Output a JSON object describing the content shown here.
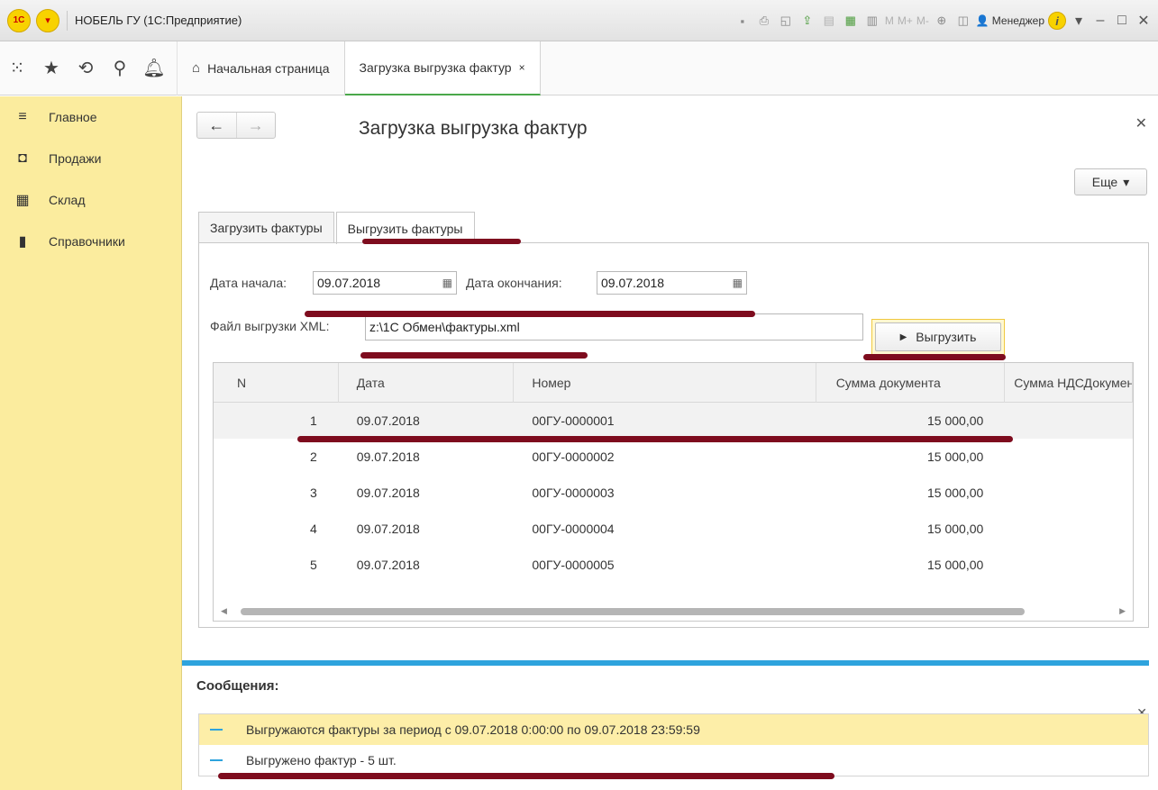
{
  "window": {
    "logo_text": "1С",
    "title": "НОБЕЛЬ ГУ  (1С:Предприятие)",
    "memory_buttons": [
      "M",
      "M+",
      "M-"
    ],
    "user": "Менеджер"
  },
  "toolbar": {
    "tabs": [
      {
        "label": "Начальная страница"
      },
      {
        "label": "Загрузка выгрузка фактур",
        "close": "×"
      }
    ]
  },
  "sidebar": {
    "items": [
      {
        "label": "Главное",
        "icon": "menu-icon"
      },
      {
        "label": "Продажи",
        "icon": "bag-icon"
      },
      {
        "label": "Склад",
        "icon": "warehouse-icon"
      },
      {
        "label": "Справочники",
        "icon": "books-icon"
      }
    ]
  },
  "page": {
    "title": "Загрузка выгрузка фактур",
    "more_label": "Еще"
  },
  "form_tabs": [
    {
      "label": "Загрузить фактуры"
    },
    {
      "label": "Выгрузить фактуры"
    }
  ],
  "form": {
    "start_label": "Дата начала:",
    "start_value": "09.07.2018",
    "end_label": "Дата окончания:",
    "end_value": "09.07.2018",
    "file_label": "Файл выгрузки XML:",
    "file_value": "z:\\1С Обмен\\фактуры.xml",
    "export_label": "Выгрузить"
  },
  "table": {
    "headers": [
      "N",
      "Дата",
      "Номер",
      "Сумма документа",
      "Сумма НДСДокумента"
    ],
    "rows": [
      [
        "1",
        "09.07.2018",
        "00ГУ-0000001",
        "15 000,00",
        ""
      ],
      [
        "2",
        "09.07.2018",
        "00ГУ-0000002",
        "15 000,00",
        ""
      ],
      [
        "3",
        "09.07.2018",
        "00ГУ-0000003",
        "15 000,00",
        ""
      ],
      [
        "4",
        "09.07.2018",
        "00ГУ-0000004",
        "15 000,00",
        ""
      ],
      [
        "5",
        "09.07.2018",
        "00ГУ-0000005",
        "15 000,00",
        ""
      ]
    ]
  },
  "messages": {
    "title": "Сообщения:",
    "items": [
      "Выгружаются фактуры за период с 09.07.2018 0:00:00 по 09.07.2018 23:59:59",
      "Выгружено фактур - 5 шт."
    ]
  },
  "colors": {
    "sidebar_bg": "#fbec9e",
    "accent_blue": "#2ea3dd",
    "active_tab_green": "#4aa84a",
    "highlight_mark": "#7e0c1e"
  }
}
